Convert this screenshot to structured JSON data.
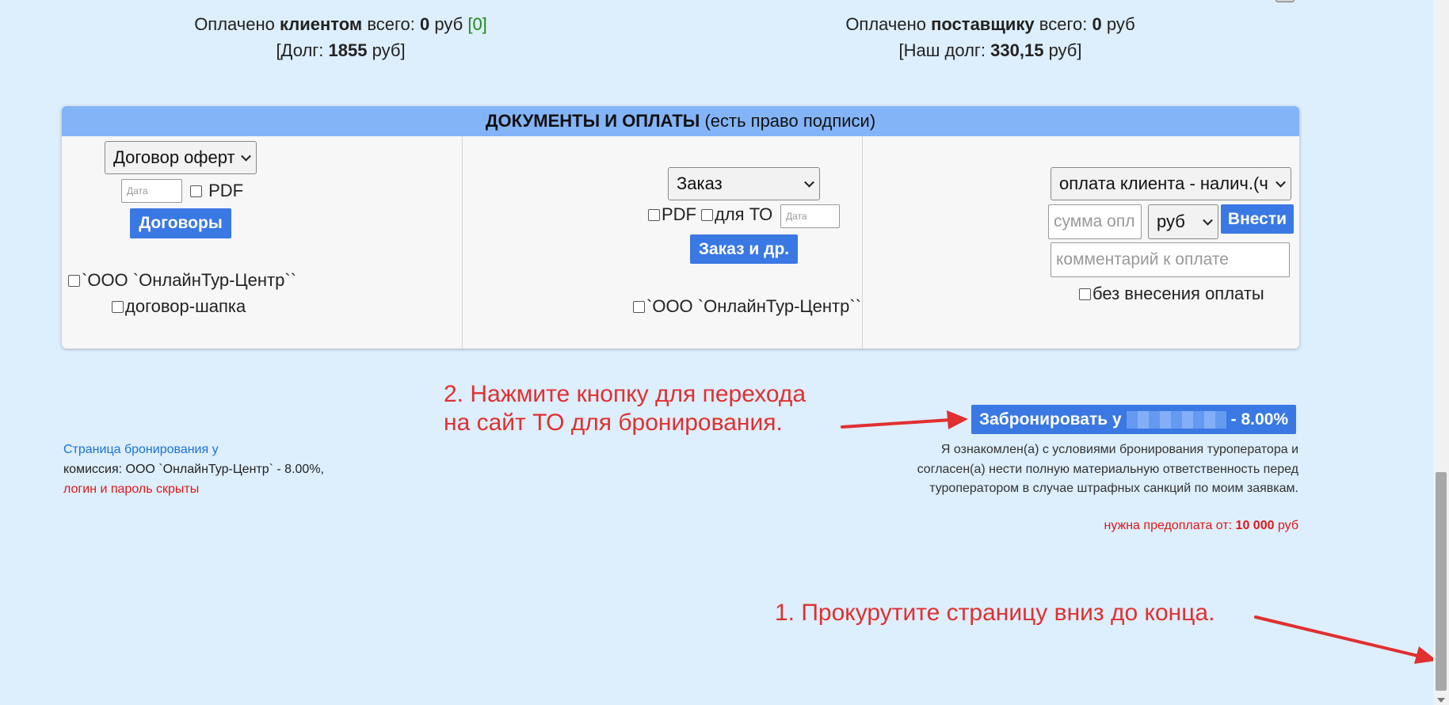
{
  "payments": {
    "client_prefix": "Оплачено ",
    "client_bold": "клиентом",
    "client_total_label": " всего: ",
    "client_total": "0",
    "client_currency": " руб ",
    "client_bracket": "[0]",
    "debt_label": "[Долг: ",
    "debt_value": "1855",
    "debt_suffix": " руб]",
    "supplier_prefix": "Оплачено ",
    "supplier_bold": "поставщику",
    "supplier_total_label": " всего: ",
    "supplier_total": "0",
    "supplier_currency": " руб",
    "our_debt_label": "[Наш долг: ",
    "our_debt_value": "330,15",
    "our_debt_suffix": " руб]"
  },
  "documents": {
    "title_bold": "ДОКУМЕНТЫ И ОПЛАТЫ",
    "title_note": " (есть право подписи)",
    "col1": {
      "contract_select": "Договор оферт",
      "date_placeholder": "Дата",
      "pdf_label": "PDF",
      "contracts_button": "Договоры",
      "company_label": "`ООО `ОнлайнТур-Центр``",
      "header_label": "договор-шапка"
    },
    "col2": {
      "order_select": "Заказ",
      "pdf_label": "PDF",
      "to_label": "для ТО",
      "date_placeholder": "Дата",
      "order_button": "Заказ и др.",
      "company_label": "`ООО `ОнлайнТур-Центр``"
    },
    "col3": {
      "payment_type_select": "оплата клиента - налич.(ч",
      "amount_placeholder": "сумма опл",
      "currency_select": "руб",
      "submit_button": "Внести",
      "comment_placeholder": "комментарий к оплате",
      "no_payment_label": "без внесения оплаты"
    }
  },
  "booking": {
    "button_prefix": "Забронировать у",
    "button_suffix": "- 8.00%",
    "terms": [
      "Я ознакомлен(а) с условиями бронирования туроператора и",
      "согласен(а) нести полную материальную ответственность перед",
      "туроператором в случае штрафных санкций по моим заявкам."
    ],
    "prepay_label": "нужна предоплата от: ",
    "prepay_value": "10 000",
    "prepay_currency": " руб"
  },
  "info": {
    "booking_page_link": "Страница бронирования у",
    "commission": "комиссия: ООО `ОнлайнТур-Центр` - 8.00%,",
    "hidden_login": "логин и пароль скрыты"
  },
  "annotations": {
    "step2_line1": "2. Нажмите кнопку для перехода",
    "step2_line2": "на сайт ТО для бронирования.",
    "step1": "1. Прокурутите страницу вниз до конца."
  },
  "colors": {
    "background": "#ddeefc",
    "header_blue": "#84b4f8",
    "button_blue": "#3a78e4",
    "annotation_red": "#e03030",
    "link_blue": "#1a73d9"
  }
}
